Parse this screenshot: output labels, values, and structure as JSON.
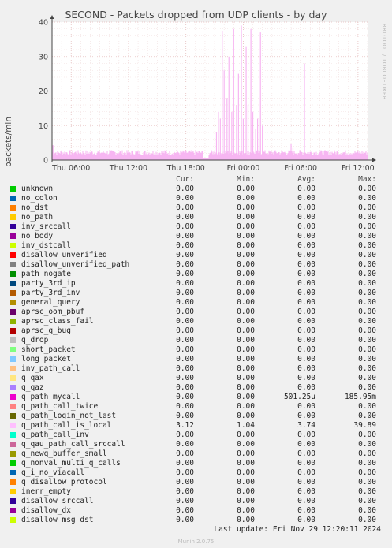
{
  "title": "SECOND - Packets dropped from UDP clients - by day",
  "side_text": "RRDTOOL / TOBI OETIKER",
  "footer": "Munin 2.0.75",
  "last_update": "Last update: Fri Nov 29 12:20:11 2024",
  "legend_header": {
    "cur": "Cur:",
    "min": "Min:",
    "avg": "Avg:",
    "max": "Max:"
  },
  "colors": {
    "background": "#f0f0f0",
    "plot_area": "#ffffff",
    "grid": "#e6c0c0",
    "series": "#f7b6f2",
    "axis": "#444444"
  },
  "chart_data": {
    "type": "line",
    "title": "SECOND - Packets dropped from UDP clients - by day",
    "ylabel": "packets/min",
    "xlabel": "",
    "ylim": [
      0,
      40
    ],
    "y_ticks": [
      0,
      10,
      20,
      30,
      40
    ],
    "x_range_hours": [
      0,
      33
    ],
    "x_ticks": [
      {
        "label": "Thu 06:00",
        "hour": 2
      },
      {
        "label": "Thu 12:00",
        "hour": 8
      },
      {
        "label": "Thu 18:00",
        "hour": 14
      },
      {
        "label": "Fri 00:00",
        "hour": 20
      },
      {
        "label": "Fri 06:00",
        "hour": 26
      },
      {
        "label": "Fri 12:00",
        "hour": 32
      }
    ],
    "grid": true,
    "series": [
      {
        "name": "q_path_call_is_local",
        "color": "#f7b6f2",
        "baseline": 2.2,
        "spikes": [
          {
            "hour": 0.1,
            "value": 4.3
          },
          {
            "hour": 17.2,
            "value": 8.0
          },
          {
            "hour": 17.4,
            "value": 14.0
          },
          {
            "hour": 17.6,
            "value": 12.0
          },
          {
            "hour": 17.8,
            "value": 37.5
          },
          {
            "hour": 18.0,
            "value": 26.0
          },
          {
            "hour": 18.3,
            "value": 18.0
          },
          {
            "hour": 18.5,
            "value": 30.0
          },
          {
            "hour": 18.8,
            "value": 14.0
          },
          {
            "hour": 19.0,
            "value": 38.0
          },
          {
            "hour": 19.3,
            "value": 16.0
          },
          {
            "hour": 19.5,
            "value": 25.0
          },
          {
            "hour": 19.8,
            "value": 39.0
          },
          {
            "hour": 20.0,
            "value": 12.0
          },
          {
            "hour": 20.3,
            "value": 33.0
          },
          {
            "hour": 20.5,
            "value": 16.0
          },
          {
            "hour": 20.8,
            "value": 38.0
          },
          {
            "hour": 21.0,
            "value": 14.0
          },
          {
            "hour": 21.3,
            "value": 9.0
          },
          {
            "hour": 21.5,
            "value": 12.0
          },
          {
            "hour": 21.8,
            "value": 37.0
          },
          {
            "hour": 22.0,
            "value": 10.0
          },
          {
            "hour": 25.0,
            "value": 4.8
          },
          {
            "hour": 25.2,
            "value": 3.5
          },
          {
            "hour": 26.4,
            "value": 28.0
          }
        ]
      }
    ]
  },
  "legend": [
    {
      "name": "unknown",
      "color": "#00cc00",
      "cur": "0.00",
      "min": "0.00",
      "avg": "0.00",
      "max": "0.00"
    },
    {
      "name": "no_colon",
      "color": "#0066b3",
      "cur": "0.00",
      "min": "0.00",
      "avg": "0.00",
      "max": "0.00"
    },
    {
      "name": "no_dst",
      "color": "#ff8000",
      "cur": "0.00",
      "min": "0.00",
      "avg": "0.00",
      "max": "0.00"
    },
    {
      "name": "no_path",
      "color": "#ffcc00",
      "cur": "0.00",
      "min": "0.00",
      "avg": "0.00",
      "max": "0.00"
    },
    {
      "name": "inv_srccall",
      "color": "#330099",
      "cur": "0.00",
      "min": "0.00",
      "avg": "0.00",
      "max": "0.00"
    },
    {
      "name": "no_body",
      "color": "#990099",
      "cur": "0.00",
      "min": "0.00",
      "avg": "0.00",
      "max": "0.00"
    },
    {
      "name": "inv_dstcall",
      "color": "#ccff00",
      "cur": "0.00",
      "min": "0.00",
      "avg": "0.00",
      "max": "0.00"
    },
    {
      "name": "disallow_unverified",
      "color": "#ff0000",
      "cur": "0.00",
      "min": "0.00",
      "avg": "0.00",
      "max": "0.00"
    },
    {
      "name": "disallow_unverified_path",
      "color": "#808080",
      "cur": "0.00",
      "min": "0.00",
      "avg": "0.00",
      "max": "0.00"
    },
    {
      "name": "path_nogate",
      "color": "#008f00",
      "cur": "0.00",
      "min": "0.00",
      "avg": "0.00",
      "max": "0.00"
    },
    {
      "name": "party_3rd_ip",
      "color": "#00487d",
      "cur": "0.00",
      "min": "0.00",
      "avg": "0.00",
      "max": "0.00"
    },
    {
      "name": "party_3rd_inv",
      "color": "#b35a00",
      "cur": "0.00",
      "min": "0.00",
      "avg": "0.00",
      "max": "0.00"
    },
    {
      "name": "general_query",
      "color": "#b38f00",
      "cur": "0.00",
      "min": "0.00",
      "avg": "0.00",
      "max": "0.00"
    },
    {
      "name": "aprsc_oom_pbuf",
      "color": "#6b006b",
      "cur": "0.00",
      "min": "0.00",
      "avg": "0.00",
      "max": "0.00"
    },
    {
      "name": "aprsc_class_fail",
      "color": "#8fb300",
      "cur": "0.00",
      "min": "0.00",
      "avg": "0.00",
      "max": "0.00"
    },
    {
      "name": "aprsc_q_bug",
      "color": "#b30000",
      "cur": "0.00",
      "min": "0.00",
      "avg": "0.00",
      "max": "0.00"
    },
    {
      "name": "q_drop",
      "color": "#bebebe",
      "cur": "0.00",
      "min": "0.00",
      "avg": "0.00",
      "max": "0.00"
    },
    {
      "name": "short_packet",
      "color": "#80ff80",
      "cur": "0.00",
      "min": "0.00",
      "avg": "0.00",
      "max": "0.00"
    },
    {
      "name": "long_packet",
      "color": "#80c9ff",
      "cur": "0.00",
      "min": "0.00",
      "avg": "0.00",
      "max": "0.00"
    },
    {
      "name": "inv_path_call",
      "color": "#ffc080",
      "cur": "0.00",
      "min": "0.00",
      "avg": "0.00",
      "max": "0.00"
    },
    {
      "name": "q_qax",
      "color": "#ffe680",
      "cur": "0.00",
      "min": "0.00",
      "avg": "0.00",
      "max": "0.00"
    },
    {
      "name": "q_qaz",
      "color": "#aa80ff",
      "cur": "0.00",
      "min": "0.00",
      "avg": "0.00",
      "max": "0.00"
    },
    {
      "name": "q_path_mycall",
      "color": "#ee00cc",
      "cur": "0.00",
      "min": "0.00",
      "avg": "501.25u",
      "max": "185.95m"
    },
    {
      "name": "q_path_call_twice",
      "color": "#ff8080",
      "cur": "0.00",
      "min": "0.00",
      "avg": "0.00",
      "max": "0.00"
    },
    {
      "name": "q_path_login_not_last",
      "color": "#666600",
      "cur": "0.00",
      "min": "0.00",
      "avg": "0.00",
      "max": "0.00"
    },
    {
      "name": "q_path_call_is_local",
      "color": "#ffbfff",
      "cur": "3.12",
      "min": "1.04",
      "avg": "3.74",
      "max": "39.89"
    },
    {
      "name": "q_path_call_inv",
      "color": "#00ffcc",
      "cur": "0.00",
      "min": "0.00",
      "avg": "0.00",
      "max": "0.00"
    },
    {
      "name": "q_qau_path_call_srccall",
      "color": "#cc6699",
      "cur": "0.00",
      "min": "0.00",
      "avg": "0.00",
      "max": "0.00"
    },
    {
      "name": "q_newq_buffer_small",
      "color": "#999900",
      "cur": "0.00",
      "min": "0.00",
      "avg": "0.00",
      "max": "0.00"
    },
    {
      "name": "q_nonval_multi_q_calls",
      "color": "#00cc00",
      "cur": "0.00",
      "min": "0.00",
      "avg": "0.00",
      "max": "0.00"
    },
    {
      "name": "q_i_no_viacall",
      "color": "#0066b3",
      "cur": "0.00",
      "min": "0.00",
      "avg": "0.00",
      "max": "0.00"
    },
    {
      "name": "q_disallow_protocol",
      "color": "#ff8000",
      "cur": "0.00",
      "min": "0.00",
      "avg": "0.00",
      "max": "0.00"
    },
    {
      "name": "inerr_empty",
      "color": "#ffcc00",
      "cur": "0.00",
      "min": "0.00",
      "avg": "0.00",
      "max": "0.00"
    },
    {
      "name": "disallow_srccall",
      "color": "#330099",
      "cur": "0.00",
      "min": "0.00",
      "avg": "0.00",
      "max": "0.00"
    },
    {
      "name": "disallow_dx",
      "color": "#990099",
      "cur": "0.00",
      "min": "0.00",
      "avg": "0.00",
      "max": "0.00"
    },
    {
      "name": "disallow_msg_dst",
      "color": "#ccff00",
      "cur": "0.00",
      "min": "0.00",
      "avg": "0.00",
      "max": "0.00"
    }
  ]
}
